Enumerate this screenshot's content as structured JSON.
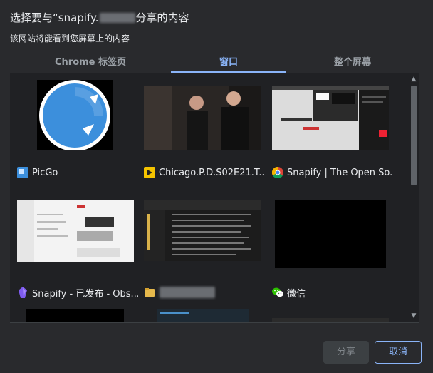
{
  "dialog": {
    "title_prefix": "选择要与“snapify.",
    "title_suffix": "分享的内容",
    "subtitle": "该网站将能看到您屏幕上的内容"
  },
  "tabs": [
    {
      "label": "Chrome 标签页",
      "active": false
    },
    {
      "label": "窗口",
      "active": true
    },
    {
      "label": "整个屏幕",
      "active": false
    }
  ],
  "windows": [
    {
      "label": "PicGo",
      "icon": "picgo-app-icon"
    },
    {
      "label": "Chicago.P.D.S02E21.T...",
      "icon": "potplayer-icon"
    },
    {
      "label": "Snapify | The Open So...",
      "icon": "chrome-icon"
    },
    {
      "label": "Snapify - 已发布 - Obs...",
      "icon": "obsidian-icon"
    },
    {
      "label": "",
      "icon": "folder-icon"
    },
    {
      "label": "微信",
      "icon": "wechat-icon"
    }
  ],
  "buttons": {
    "share": "分享",
    "cancel": "取消"
  },
  "colors": {
    "accent": "#8ab4f8",
    "background": "#292a2d",
    "panel": "#202124"
  }
}
